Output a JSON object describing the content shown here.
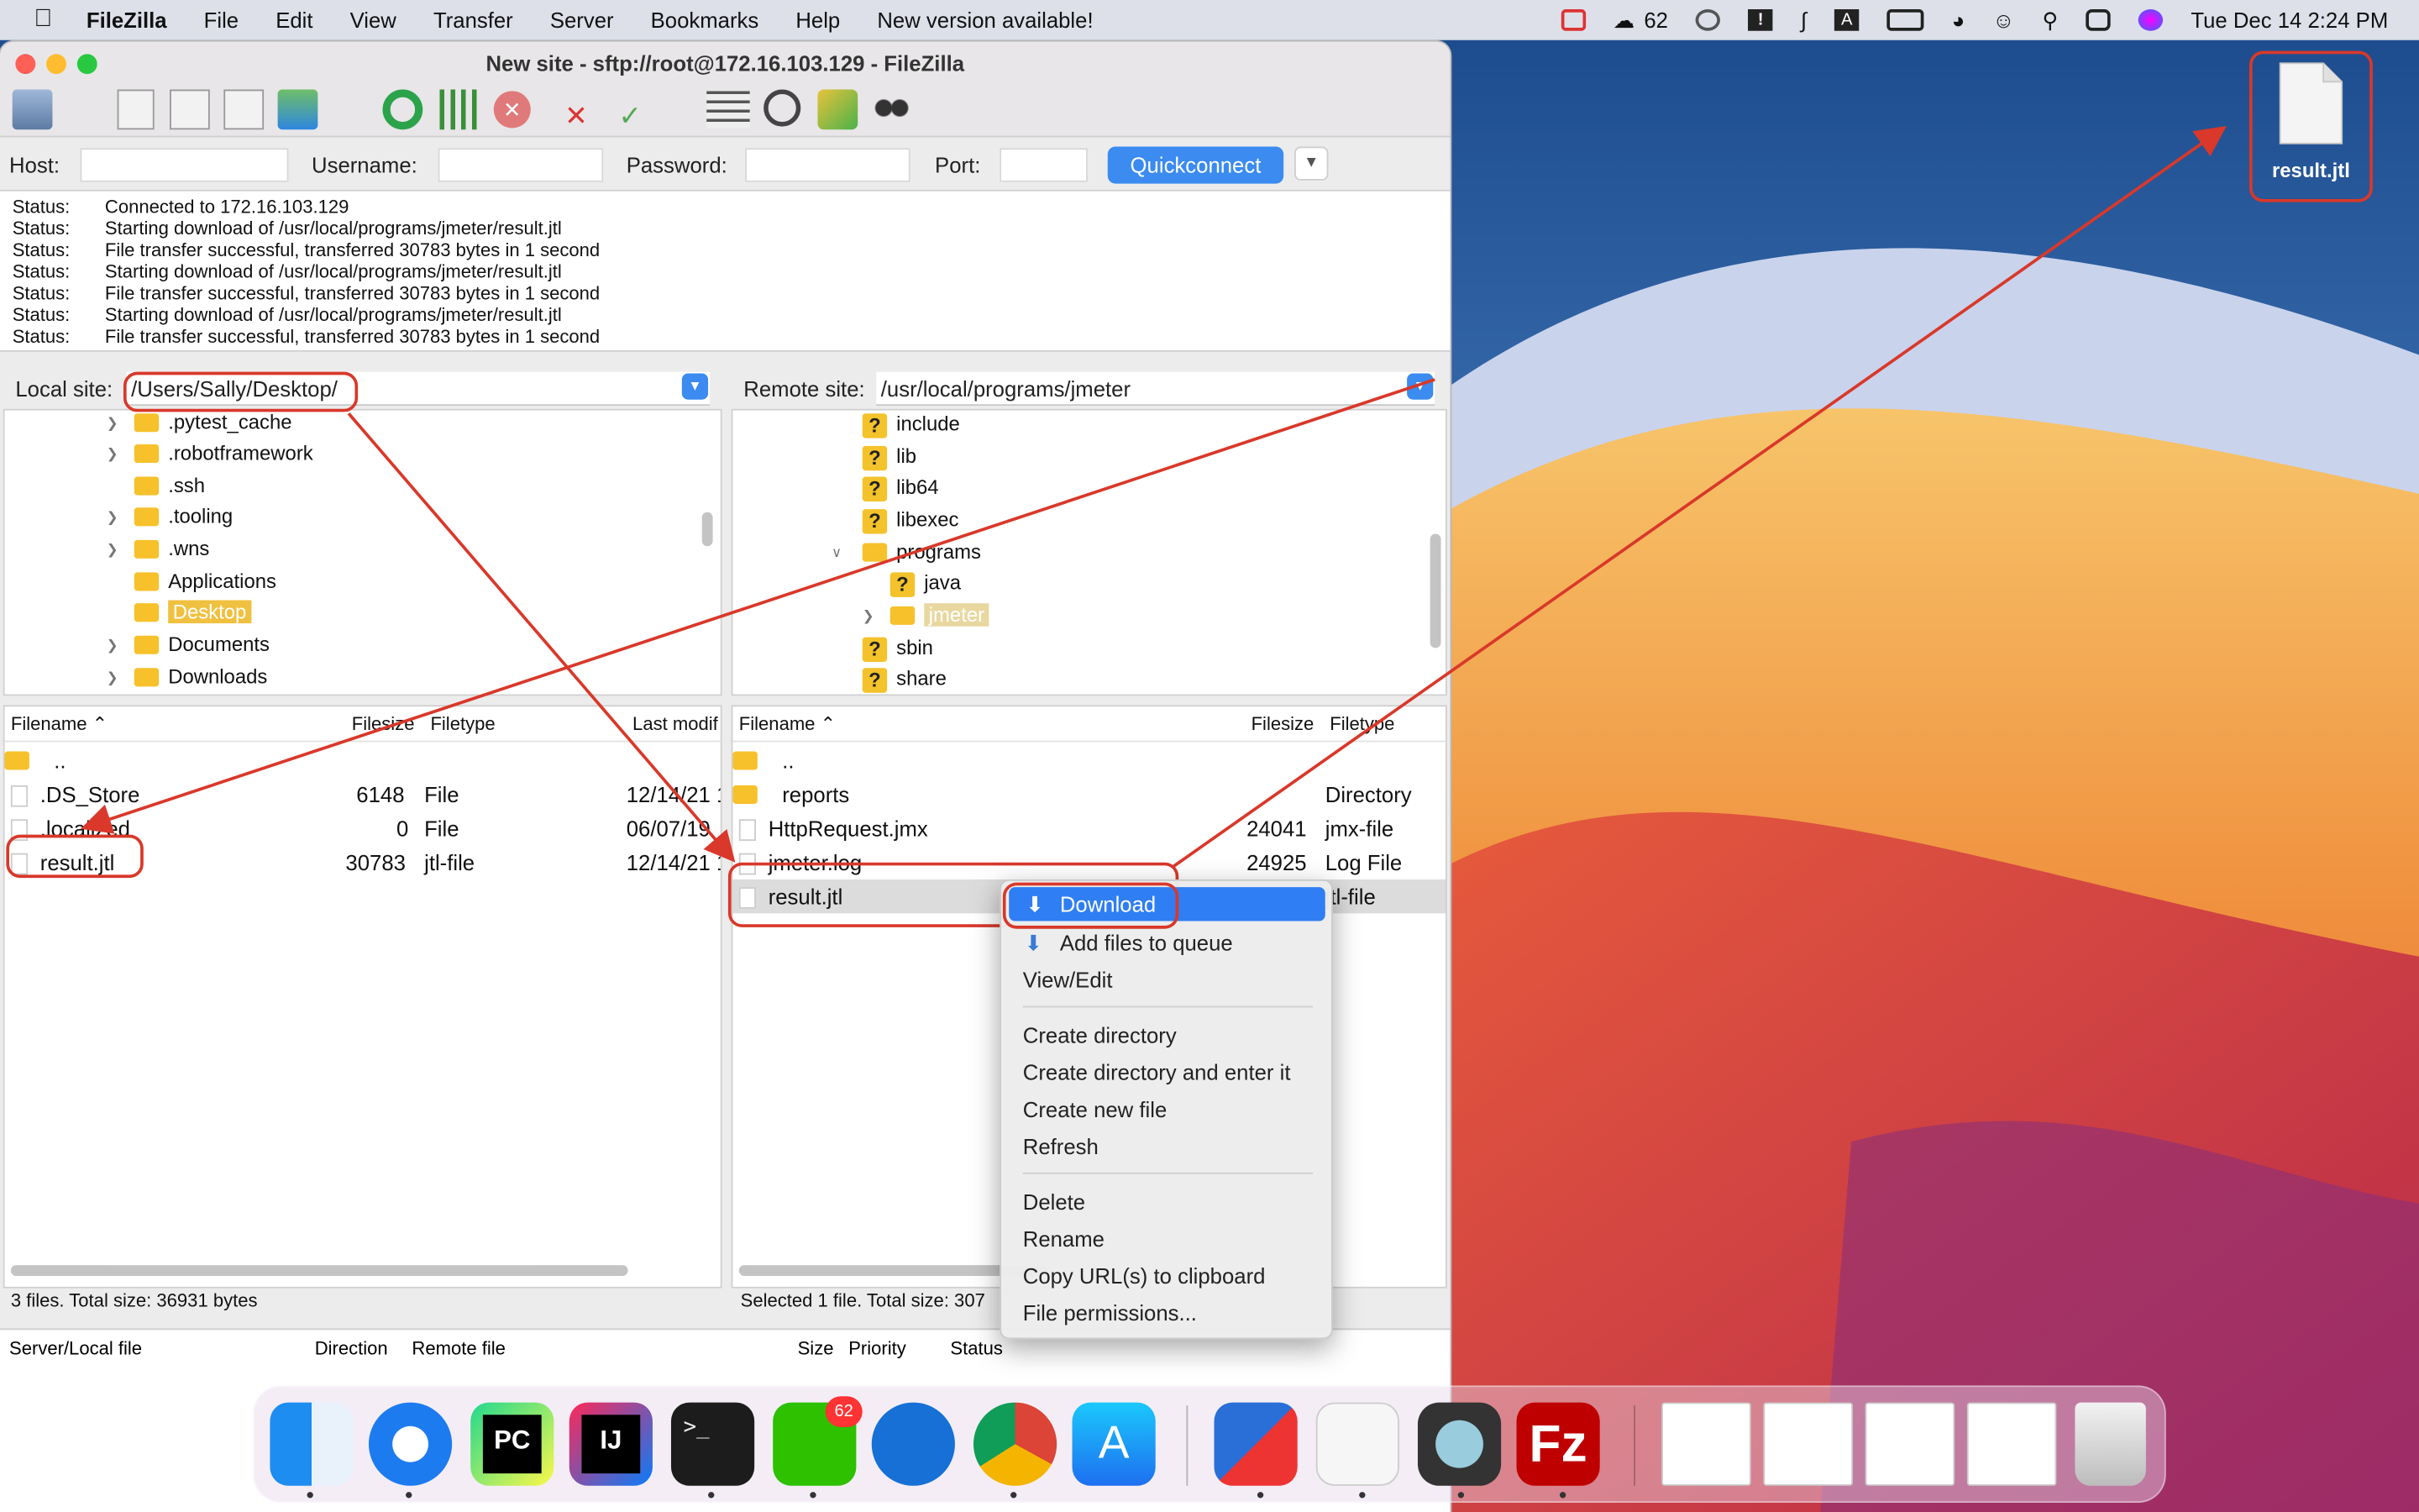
{
  "menubar": {
    "app": "FileZilla",
    "items": [
      "File",
      "Edit",
      "View",
      "Transfer",
      "Server",
      "Bookmarks",
      "Help",
      "New version available!"
    ],
    "wechat_count": "62",
    "clock": "Tue Dec 14  2:24 PM"
  },
  "window": {
    "title": "New site - sftp://root@172.16.103.129 - FileZilla"
  },
  "quickconnect": {
    "host_label": "Host:",
    "username_label": "Username:",
    "password_label": "Password:",
    "port_label": "Port:",
    "button": "Quickconnect"
  },
  "log": [
    {
      "k": "Status:",
      "v": "Connected to 172.16.103.129"
    },
    {
      "k": "Status:",
      "v": "Starting download of /usr/local/programs/jmeter/result.jtl"
    },
    {
      "k": "Status:",
      "v": "File transfer successful, transferred 30783 bytes in 1 second"
    },
    {
      "k": "Status:",
      "v": "Starting download of /usr/local/programs/jmeter/result.jtl"
    },
    {
      "k": "Status:",
      "v": "File transfer successful, transferred 30783 bytes in 1 second"
    },
    {
      "k": "Status:",
      "v": "Starting download of /usr/local/programs/jmeter/result.jtl"
    },
    {
      "k": "Status:",
      "v": "File transfer successful, transferred 30783 bytes in 1 second"
    }
  ],
  "local": {
    "label": "Local site:",
    "path": "/Users/Sally/Desktop/",
    "tree": [
      ".pytest_cache",
      ".robotframework",
      ".ssh",
      ".tooling",
      ".wns",
      "Applications",
      "Desktop",
      "Documents",
      "Downloads"
    ],
    "headers": {
      "filename": "Filename",
      "filesize": "Filesize",
      "filetype": "Filetype",
      "modified": "Last modif"
    },
    "files": [
      {
        "name": "..",
        "size": "",
        "type": "",
        "date": ""
      },
      {
        "name": ".DS_Store",
        "size": "6148",
        "type": "File",
        "date": "12/14/21 1"
      },
      {
        "name": ".localized",
        "size": "0",
        "type": "File",
        "date": "06/07/19"
      },
      {
        "name": "result.jtl",
        "size": "30783",
        "type": "jtl-file",
        "date": "12/14/21 1"
      }
    ],
    "status": "3 files. Total size: 36931 bytes"
  },
  "remote": {
    "label": "Remote site:",
    "path": "/usr/local/programs/jmeter",
    "tree": [
      "include",
      "lib",
      "lib64",
      "libexec",
      "programs",
      "java",
      "jmeter",
      "sbin",
      "share"
    ],
    "headers": {
      "filename": "Filename",
      "filesize": "Filesize",
      "filetype": "Filetype"
    },
    "files": [
      {
        "name": "..",
        "size": "",
        "type": ""
      },
      {
        "name": "reports",
        "size": "",
        "type": "Directory"
      },
      {
        "name": "HttpRequest.jmx",
        "size": "24041",
        "type": "jmx-file"
      },
      {
        "name": "jmeter.log",
        "size": "24925",
        "type": "Log File"
      },
      {
        "name": "result.jtl",
        "size": "",
        "type": "jtl-file"
      }
    ],
    "status": "Selected 1 file. Total size: 307"
  },
  "queue_headers": [
    "Server/Local file",
    "Direction",
    "Remote file",
    "Size",
    "Priority",
    "Status"
  ],
  "context_menu": {
    "group1": [
      "Download",
      "Add files to queue",
      "View/Edit"
    ],
    "group2": [
      "Create directory",
      "Create directory and enter it",
      "Create new file",
      "Refresh"
    ],
    "group3": [
      "Delete",
      "Rename",
      "Copy URL(s) to clipboard",
      "File permissions..."
    ]
  },
  "desktop_file": "result.jtl",
  "dock_badge": "62",
  "colors": {
    "accent": "#3b8bf0",
    "annotation": "#d9382a",
    "folder": "#f7c12b"
  }
}
